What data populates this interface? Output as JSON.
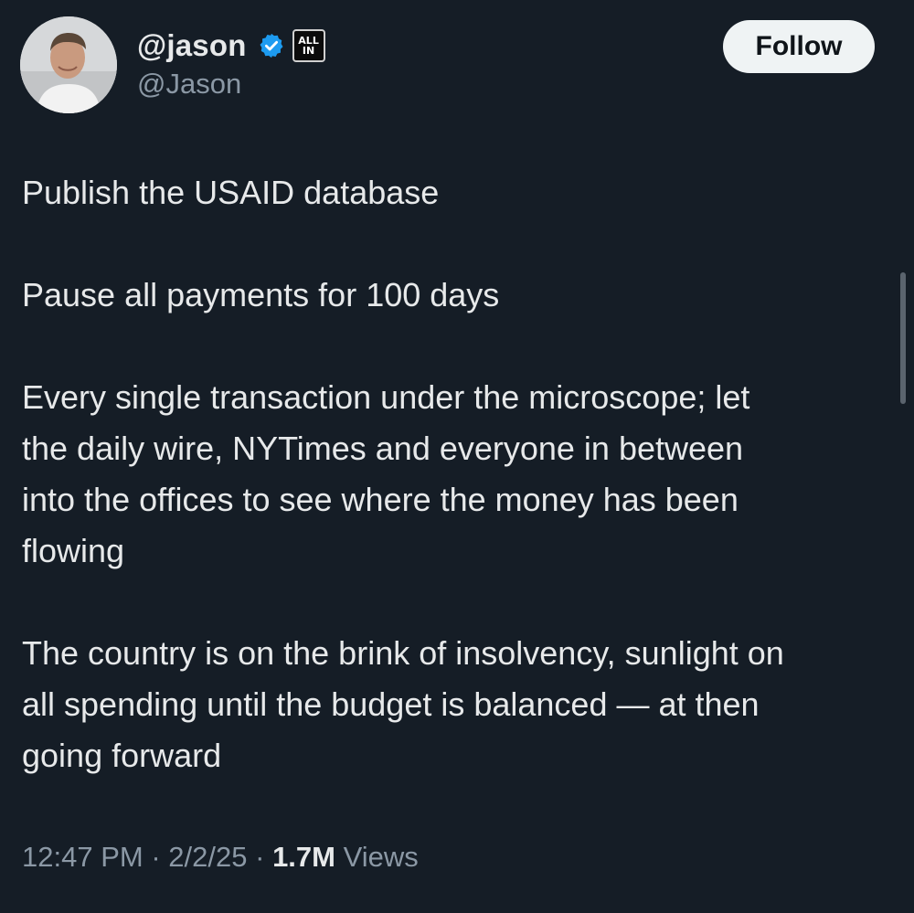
{
  "user": {
    "display_name": "@jason",
    "handle": "@Jason",
    "avatar_icon": "profile-photo",
    "verified_icon": "verified-badge-icon",
    "affiliate_badge": {
      "line1": "ALL",
      "line2": "IN"
    }
  },
  "follow_button": {
    "label": "Follow"
  },
  "tweet": {
    "paragraphs": [
      "Publish the USAID database",
      "Pause all payments for 100 days",
      "Every single transaction under the microscope; let\nthe daily wire, NYTimes and everyone in between\ninto the offices to see where the money has been\nflowing",
      "The country is on the brink of insolvency, sunlight on\nall spending until the budget is balanced — at then\ngoing forward"
    ],
    "time": "12:47 PM",
    "separator": "·",
    "date": "2/2/25",
    "views_count": "1.7M",
    "views_label": "Views"
  },
  "colors": {
    "background": "#151d26",
    "primary_text": "#e7e9ea",
    "secondary_text": "#8b98a5",
    "verified_blue": "#1d9bf0",
    "button_bg": "#eff3f4"
  }
}
